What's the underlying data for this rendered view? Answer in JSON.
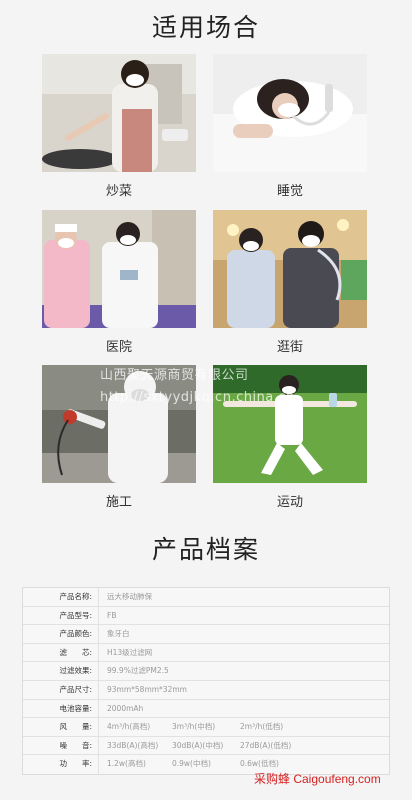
{
  "usage_section": {
    "title": "适用场合",
    "scenes": [
      {
        "label": "炒菜",
        "icon": "cooking-photo"
      },
      {
        "label": "睡觉",
        "icon": "sleeping-photo"
      },
      {
        "label": "医院",
        "icon": "hospital-photo"
      },
      {
        "label": "逛街",
        "icon": "shopping-photo"
      },
      {
        "label": "施工",
        "icon": "construction-photo"
      },
      {
        "label": "运动",
        "icon": "exercise-photo"
      }
    ]
  },
  "watermark": {
    "line1": "山西聚天源商贸有限公司",
    "line2": "http://sxtyydjkq.cn.china.cn"
  },
  "profile_section": {
    "title": "产品档案",
    "specs": [
      {
        "label": "产品名称:",
        "values": [
          "远大移动肺保"
        ]
      },
      {
        "label": "产品型号:",
        "values": [
          "FB"
        ]
      },
      {
        "label": "产品颜色:",
        "values": [
          "象牙白"
        ]
      },
      {
        "label": "滤　　芯:",
        "values": [
          "H13级过滤网"
        ]
      },
      {
        "label": "过滤效果:",
        "values": [
          "99.9%过滤PM2.5"
        ]
      },
      {
        "label": "产品尺寸:",
        "values": [
          "93mm*58mm*32mm"
        ]
      },
      {
        "label": "电池容量:",
        "values": [
          "2000mAh"
        ]
      },
      {
        "label": "风　　量:",
        "values": [
          "4m³/h(高档)",
          "3m³/h(中档)",
          "2m³/h(低档)"
        ]
      },
      {
        "label": "噪　　音:",
        "values": [
          "33dB(A)(高档)",
          "30dB(A)(中档)",
          "27dB(A)(低档)"
        ]
      },
      {
        "label": "功　　率:",
        "values": [
          "1.2w(高档)",
          "0.9w(中档)",
          "0.6w(低档)"
        ]
      }
    ]
  },
  "footer": {
    "brand": "采购蜂 Caigoufeng.com"
  },
  "colors": {
    "background": "#f4f4f4",
    "brand_red": "#d62020",
    "spec_value": "#9a9a9a"
  }
}
